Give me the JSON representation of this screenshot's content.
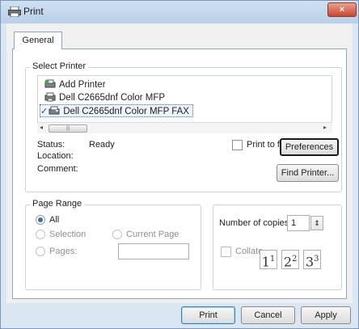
{
  "window": {
    "title": "Print",
    "close_glyph": "×"
  },
  "tabs": [
    {
      "label": "General"
    }
  ],
  "select_printer": {
    "group_label": "Select Printer",
    "printers": [
      {
        "label": "Add Printer",
        "icon": "add-printer-icon"
      },
      {
        "label": "Dell C2665dnf Color MFP",
        "icon": "printer-icon"
      },
      {
        "label": "Dell C2665dnf Color MFP FAX",
        "icon": "fax-printer-icon",
        "selected": true,
        "default_check": "✓"
      }
    ],
    "scroll_left": "◂",
    "scroll_right": "▸",
    "scroll_thumb": "|||",
    "status_label": "Status:",
    "status_value": "Ready",
    "location_label": "Location:",
    "location_value": "",
    "comment_label": "Comment:",
    "comment_value": "",
    "print_to_file_label": "Print to file",
    "print_to_file_checked": false,
    "preferences_button": "Preferences",
    "find_printer_button": "Find Printer..."
  },
  "page_range": {
    "group_label": "Page Range",
    "all_label": "All",
    "all_checked": true,
    "selection_label": "Selection",
    "current_page_label": "Current Page",
    "pages_label": "Pages:",
    "pages_value": ""
  },
  "copies": {
    "number_label": "Number of copies:",
    "number_value": "1",
    "spin_glyph": "⇕",
    "collate_label": "Collate",
    "collate_checked": false,
    "collate_pages": [
      {
        "big": "1",
        "small": "1"
      },
      {
        "big": "2",
        "small": "2"
      },
      {
        "big": "3",
        "small": "3"
      }
    ]
  },
  "buttons": {
    "print": "Print",
    "cancel": "Cancel",
    "apply": "Apply"
  },
  "colors": {
    "frame": "#dbe6f3",
    "close_button": "#c9462c",
    "selection_accent": "#3b6fb0"
  }
}
